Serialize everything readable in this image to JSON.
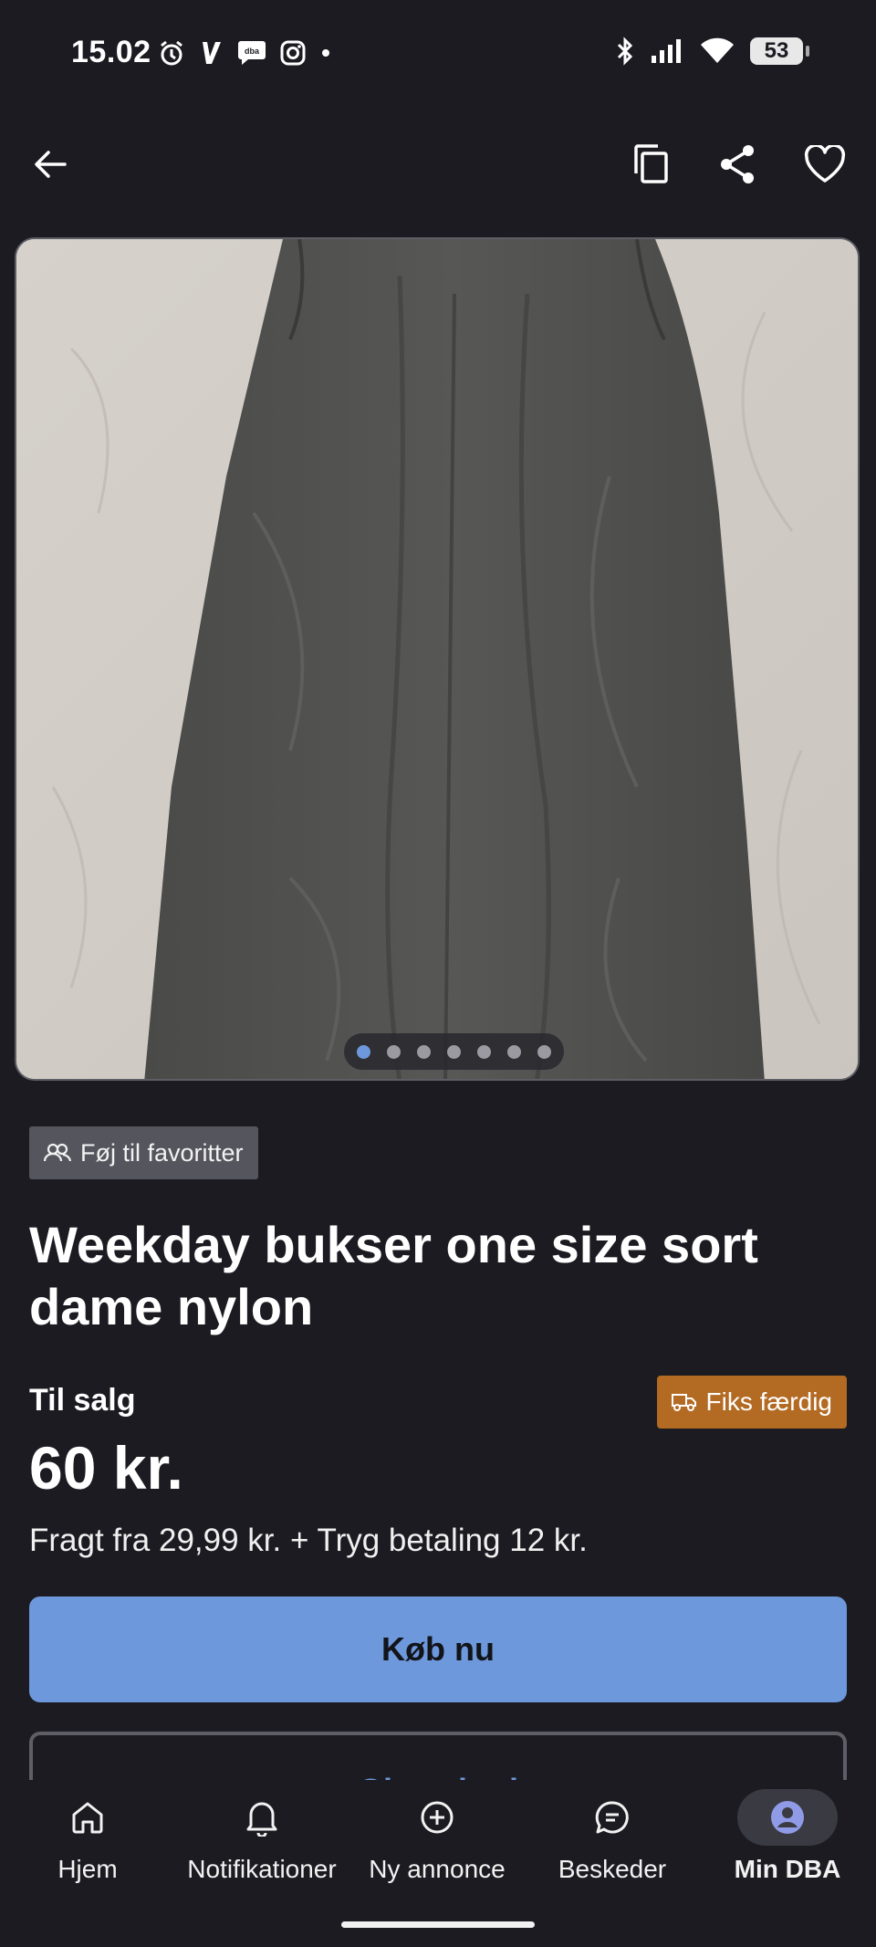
{
  "status_bar": {
    "time": "15.02",
    "battery": "53",
    "icons_left": [
      "alarm-icon",
      "v-app-icon",
      "dba-chat-icon",
      "instagram-icon",
      "dot-icon"
    ],
    "icons_right": [
      "bluetooth-icon",
      "signal-icon",
      "wifi-icon"
    ]
  },
  "app_bar": {
    "back": "arrow-left-icon",
    "actions": [
      "copy-icon",
      "share-icon",
      "heart-icon"
    ]
  },
  "gallery": {
    "image_description": "black wide-leg trousers on beige sheet",
    "photo_count": 7,
    "active_index": 0
  },
  "favorites_chip": {
    "label": "Føj til favoritter"
  },
  "listing": {
    "title": "Weekday bukser one size sort dame nylon",
    "status": "Til salg",
    "badge": "Fiks færdig",
    "price": "60 kr.",
    "shipping": "Fragt fra 29,99 kr. + Tryg betaling 12 kr."
  },
  "actions": {
    "buy": "Køb nu",
    "bid": "Giv et bud"
  },
  "bottom_nav": [
    {
      "label": "Hjem",
      "icon": "home-icon"
    },
    {
      "label": "Notifikationer",
      "icon": "bell-icon"
    },
    {
      "label": "Ny annonce",
      "icon": "plus-circle-icon"
    },
    {
      "label": "Beskeder",
      "icon": "chat-icon"
    },
    {
      "label": "Min DBA",
      "icon": "profile-icon",
      "active": true
    }
  ],
  "colors": {
    "background": "#1c1b21",
    "accent": "#6d98dc",
    "badge": "#b36a22",
    "chip": "#55555d"
  }
}
